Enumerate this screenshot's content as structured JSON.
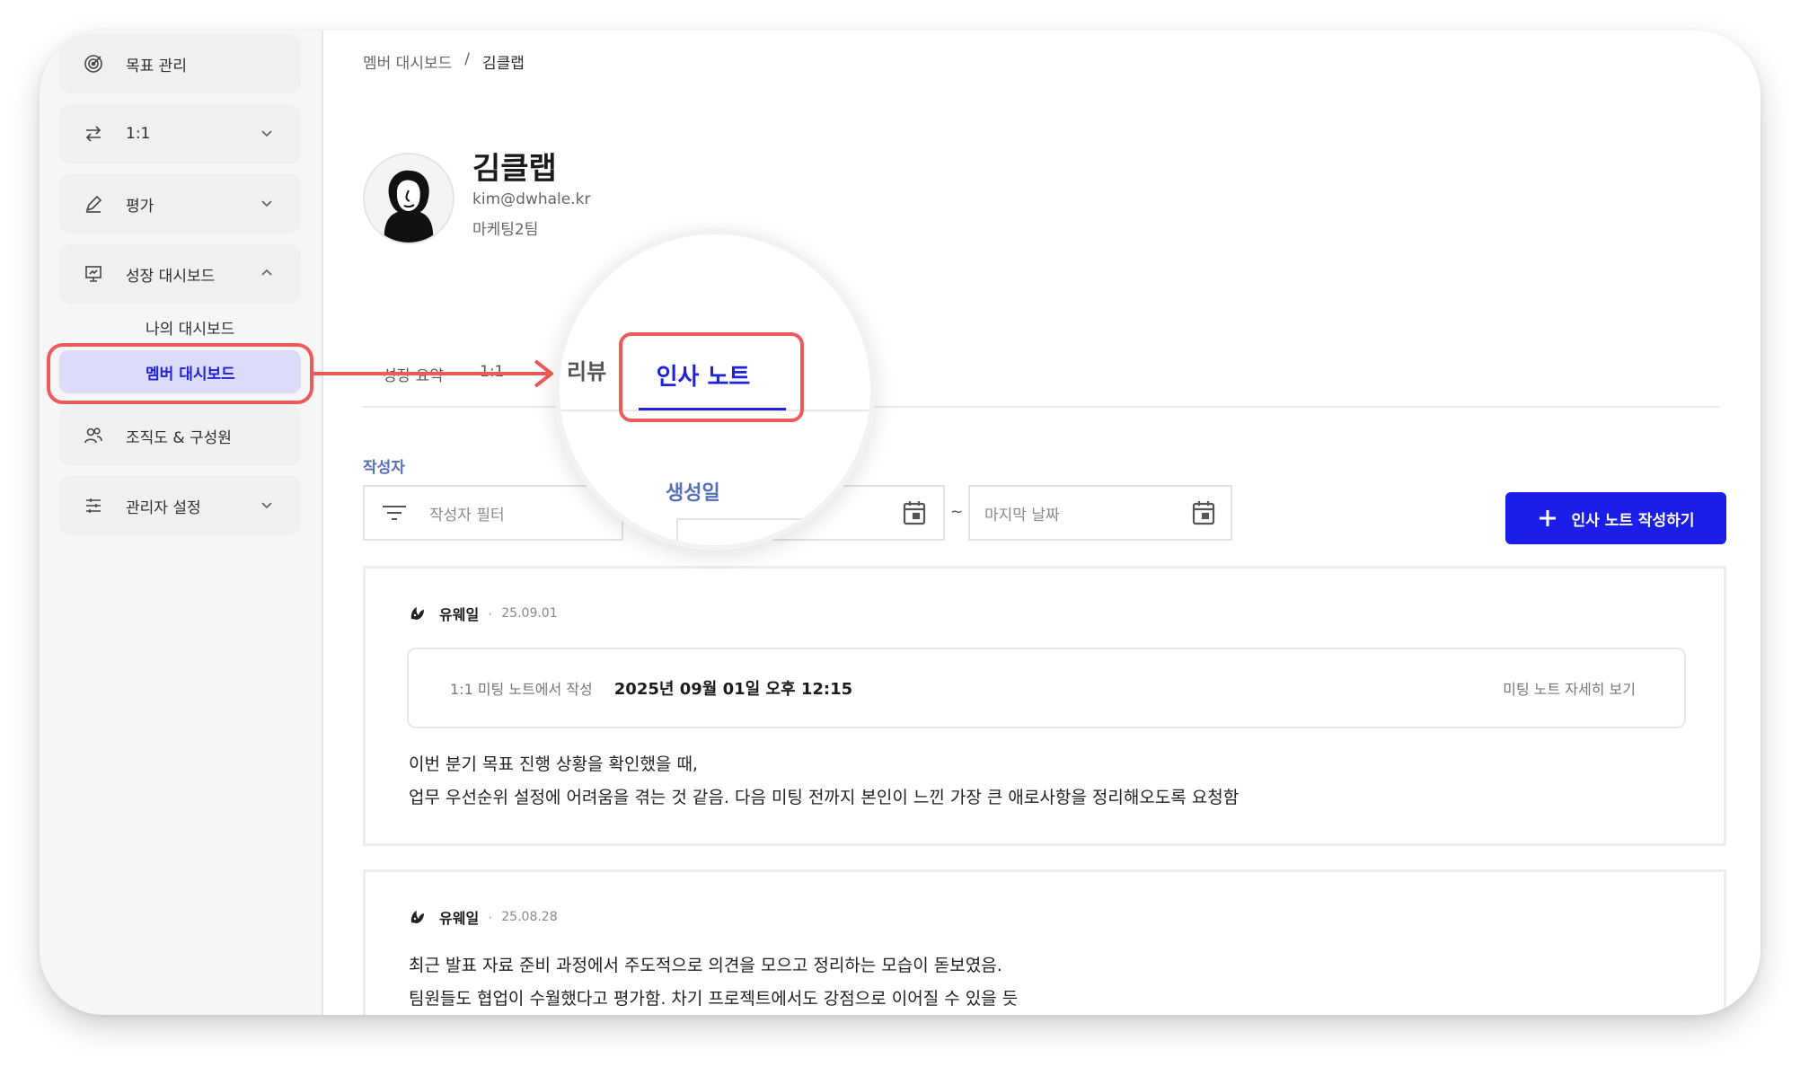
{
  "sidebar": {
    "items": [
      {
        "label": "목표 관리"
      },
      {
        "label": "1:1"
      },
      {
        "label": "평가"
      },
      {
        "label": "성장 대시보드"
      },
      {
        "label": "조직도 & 구성원"
      },
      {
        "label": "관리자 설정"
      }
    ],
    "sub_items": [
      {
        "label": "나의 대시보드"
      },
      {
        "label": "멤버 대시보드"
      }
    ]
  },
  "breadcrumb": {
    "parent": "멤버 대시보드",
    "separator": "/",
    "current": "김클랩"
  },
  "profile": {
    "name": "김클랩",
    "email": "kim@dwhale.kr",
    "team": "마케팅2팀"
  },
  "tabs": [
    {
      "label": "성장 요약"
    },
    {
      "label": "1:1"
    },
    {
      "label": "리뷰"
    },
    {
      "label": "인사 노트"
    }
  ],
  "filters": {
    "author_label": "작성자",
    "author_placeholder": "작성자 필터",
    "date_label": "생성일",
    "date_separator": "~",
    "end_placeholder": "마지막 날짜"
  },
  "create_button": {
    "label": "인사 노트 작성하기"
  },
  "notes": [
    {
      "author": "유웨일",
      "date": "25.09.01",
      "meeting_source": "1:1 미팅 노트에서 작성",
      "meeting_datetime": "2025년 09월 01일 오후 12:15",
      "meeting_link": "미팅 노트 자세히 보기",
      "lines": [
        "이번 분기 목표 진행 상황을 확인했을 때,",
        "업무 우선순위 설정에 어려움을 겪는 것 같음. 다음 미팅 전까지 본인이 느낀 가장 큰 애로사항을 정리해오도록 요청함"
      ]
    },
    {
      "author": "유웨일",
      "date": "25.08.28",
      "lines": [
        "최근 발표 자료 준비 과정에서 주도적으로 의견을 모으고 정리하는 모습이 돋보였음.",
        "팀원들도 협업이 수월했다고 평가함. 차기 프로젝트에서도 강점으로 이어질 수 있을 듯"
      ]
    }
  ],
  "colors": {
    "accent": "#1f22d8",
    "button": "#1a1ee6",
    "active_bg": "#dcdcfa",
    "highlight": "#ee5a5a",
    "label": "#5570b4"
  },
  "icons": [
    "target-icon",
    "exchange-icon",
    "pen-icon",
    "presentation-icon",
    "people-icon",
    "sliders-icon",
    "chevron-down-icon",
    "chevron-up-icon",
    "filter-icon",
    "calendar-icon",
    "plus-icon",
    "whale-icon"
  ]
}
